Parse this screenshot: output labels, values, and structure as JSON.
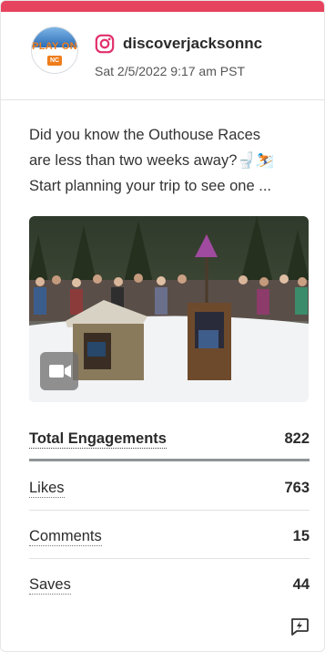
{
  "post": {
    "account_name": "discoverjacksonnc",
    "date": "Sat 2/5/2022 9:17 am PST",
    "text_line1": "Did you know the Outhouse Races",
    "text_line2": "are less than two weeks away?🚽⛷️",
    "text_line3": "Start planning your trip to see one ...",
    "logo_text": "PLAY ON",
    "logo_sub": "NC"
  },
  "engagement": {
    "total_label": "Total Engagements",
    "total_value": "822",
    "likes_label": "Likes",
    "likes_value": "763",
    "comments_label": "Comments",
    "comments_value": "15",
    "saves_label": "Saves",
    "saves_value": "44"
  },
  "colors": {
    "accent_bar": "#e6435e",
    "instagram": "#e1306c"
  },
  "icons": {
    "platform": "instagram-icon",
    "media": "video-camera-icon",
    "action": "lightning-bubble-icon"
  }
}
